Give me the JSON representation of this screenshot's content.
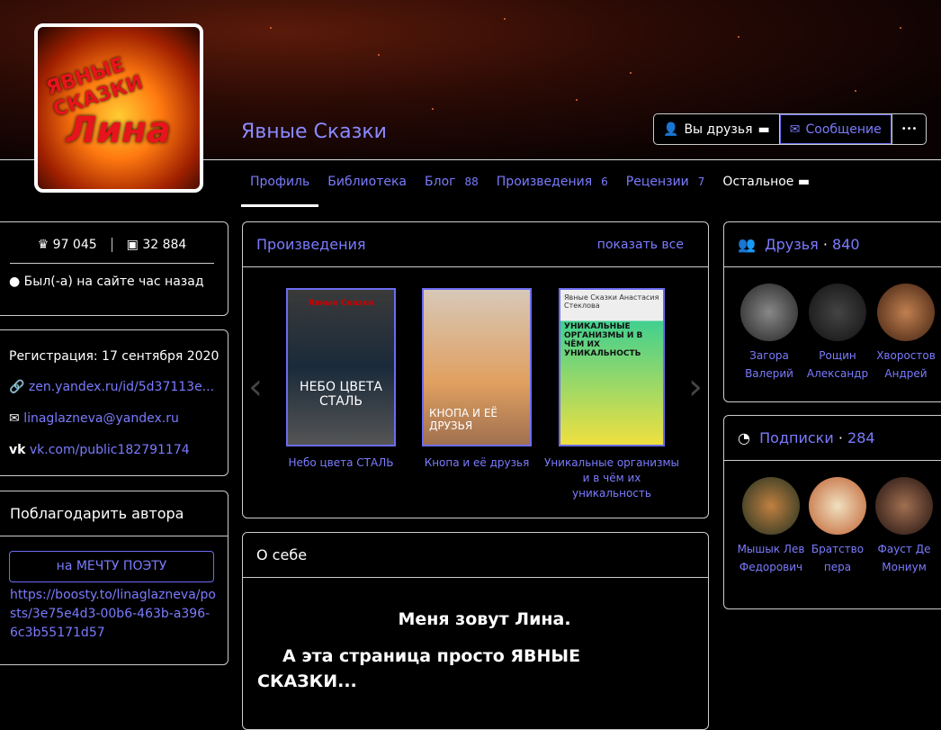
{
  "profile": {
    "name": "Явные Сказки",
    "logo_text_top": "ЯВНЫЕ СКАЗКИ",
    "logo_text_bottom": "Лина"
  },
  "actions": {
    "friends": "Вы друзья",
    "message": "Сообщение",
    "more": "•••"
  },
  "nav": [
    {
      "label": "Профиль",
      "count": ""
    },
    {
      "label": "Библиотека",
      "count": ""
    },
    {
      "label": "Блог",
      "count": "88"
    },
    {
      "label": "Произведения",
      "count": "6"
    },
    {
      "label": "Рецензии",
      "count": "7"
    },
    {
      "label": "Остальное",
      "count": ""
    }
  ],
  "stats": {
    "rating": "97 045",
    "readers": "32 884",
    "status": "Был(-а) на сайте час назад"
  },
  "info": {
    "registration": "Регистрация: 17 сентября 2020",
    "site": "zen.yandex.ru/id/5d37113e...",
    "email": "linaglazneva@yandex.ru",
    "vk": "vk.com/public182791174"
  },
  "thanks": {
    "title": "Поблагодарить автора",
    "button": "на МЕЧТУ ПОЭТУ",
    "link": "https://boosty.to/linaglazneva/posts/3e75e4d3-00b6-463b-a396-6c3b55171d57"
  },
  "works": {
    "title": "Произведения",
    "show_all": "показать все",
    "books": [
      {
        "title": "Небо цвета СТАЛЬ",
        "cover_top": "Явные Сказки",
        "cover_text": "НЕБО ЦВЕТА СТАЛЬ"
      },
      {
        "title": "Кнопа и её друзья",
        "cover_text": "КНОПА И ЕЁ ДРУЗЬЯ"
      },
      {
        "title": "Уникальные организмы и в чём их уникальность",
        "cover_top": "Явные Сказки Анастасия Стеклова",
        "cover_text": "УНИКАЛЬНЫЕ ОРГАНИЗМЫ И В ЧЁМ ИХ УНИКАЛЬНОСТЬ"
      }
    ]
  },
  "about": {
    "title": "О себе",
    "line1": "Меня зовут Лина.",
    "line2": "А эта страница просто ЯВНЫЕ СКАЗКИ..."
  },
  "friends": {
    "title": "Друзья",
    "count": "840",
    "people": [
      {
        "first": "Загора",
        "last": "Валерий"
      },
      {
        "first": "Рощин",
        "last": "Александр"
      },
      {
        "first": "Хворостов",
        "last": "Андрей"
      }
    ]
  },
  "subs": {
    "title": "Подписки",
    "count": "284",
    "people": [
      {
        "first": "Мышык Лев",
        "last": "Федорович"
      },
      {
        "first": "Братство",
        "last": "пера"
      },
      {
        "first": "Фауст Де",
        "last": "Мониум"
      }
    ]
  }
}
